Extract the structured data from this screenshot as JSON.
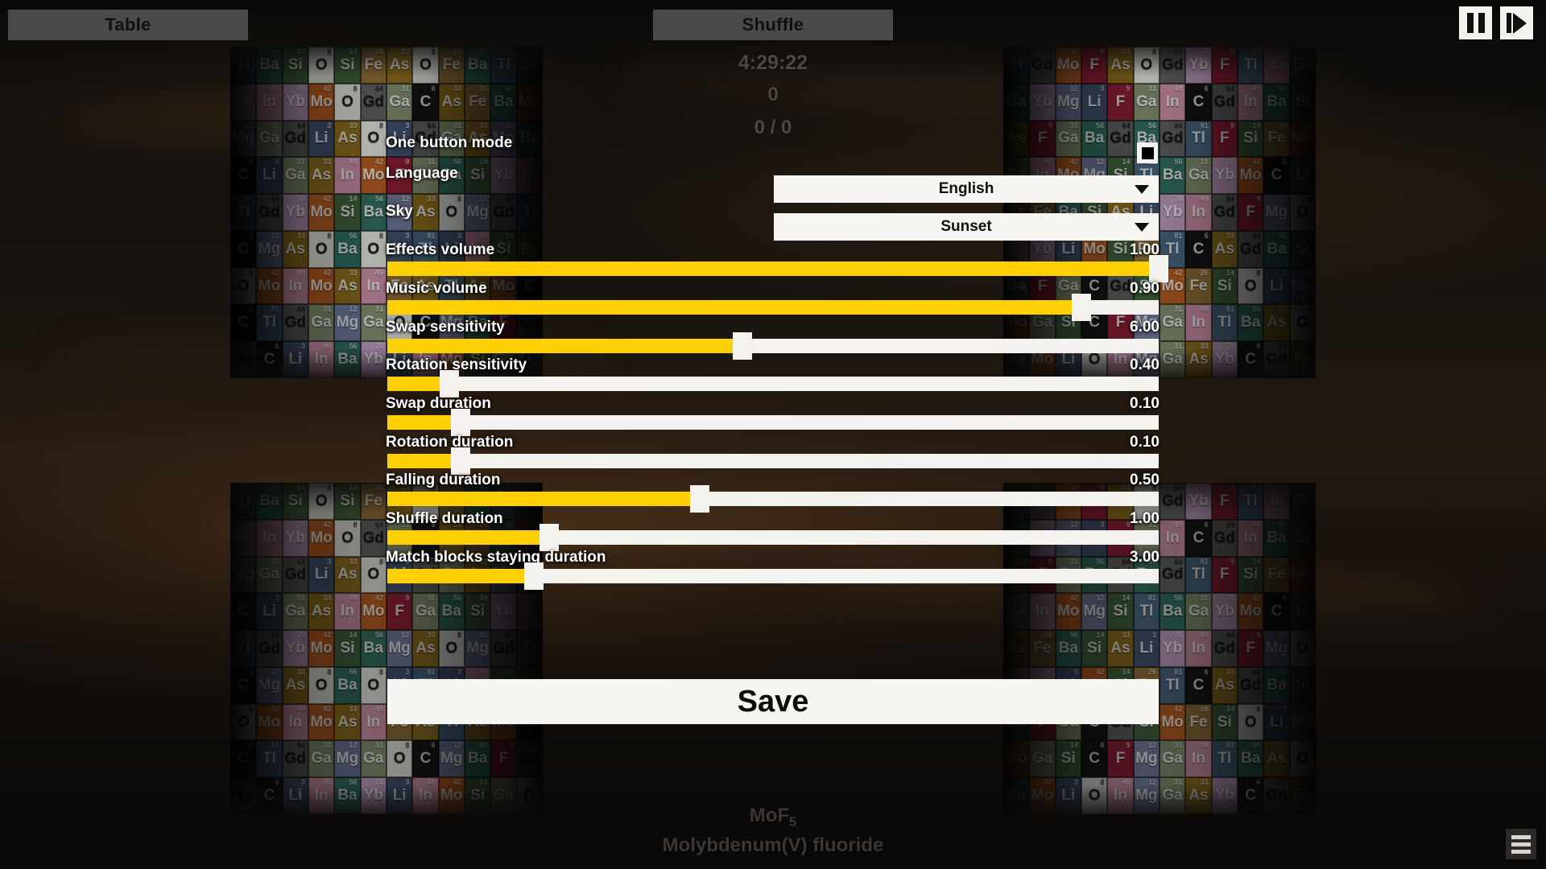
{
  "topbar": {
    "table_label": "Table",
    "shuffle_label": "Shuffle",
    "pause_icon": "pause-icon",
    "step_icon": "step-forward-icon"
  },
  "hud": {
    "timer": "4:29:22",
    "score": "0",
    "pairs": "0 / 0"
  },
  "settings": {
    "one_button_mode": {
      "label": "One button mode",
      "checked": false
    },
    "language": {
      "label": "Language",
      "value": "English"
    },
    "sky": {
      "label": "Sky",
      "value": "Sunset"
    },
    "sliders": [
      {
        "label": "Effects volume",
        "value": "1.00",
        "pct": 100.0
      },
      {
        "label": "Music volume",
        "value": "0.90",
        "pct": 90.0
      },
      {
        "label": "Swap sensitivity",
        "value": "6.00",
        "pct": 46.0
      },
      {
        "label": "Rotation sensitivity",
        "value": "0.40",
        "pct": 8.0
      },
      {
        "label": "Swap duration",
        "value": "0.10",
        "pct": 9.5
      },
      {
        "label": "Rotation duration",
        "value": "0.10",
        "pct": 9.5
      },
      {
        "label": "Falling duration",
        "value": "0.50",
        "pct": 40.5
      },
      {
        "label": "Shuffle duration",
        "value": "1.00",
        "pct": 21.0
      },
      {
        "label": "Match blocks staying duration",
        "value": "3.00",
        "pct": 19.0
      }
    ],
    "save_label": "Save"
  },
  "footer": {
    "formula_prefix": "MoF",
    "formula_subscript": "5",
    "compound_name": "Molybdenum(V) fluoride",
    "menu_icon": "list-menu-icon"
  },
  "colors": {
    "accent": "#ffd000",
    "panel": "#f7f5f1",
    "button": "#4a4a4a",
    "text_light": "#ffffff",
    "text_dim": "#4c4844"
  },
  "background": {
    "left_cylinder_rows": [
      [
        "Tl",
        "Ba",
        "Si",
        "O",
        "Si",
        "Fe",
        "As",
        "O",
        "Fe",
        "Ba",
        "Tl",
        "Si"
      ],
      [
        "Yb",
        "In",
        "Yb",
        "Mo",
        "O",
        "Gd",
        "Ga",
        "C",
        "As",
        "Fe",
        "Ba",
        "Mo"
      ],
      [
        "Mg",
        "Ga",
        "Gd",
        "Li",
        "As",
        "O",
        "Li",
        "Gd",
        "Ga",
        "As",
        "Mg",
        "Ba"
      ],
      [
        "C",
        "Li",
        "Ga",
        "As",
        "In",
        "Mo",
        "F",
        "Ga",
        "Ba",
        "Si",
        "Yb",
        "In"
      ],
      [
        "Tl",
        "Gd",
        "Yb",
        "Mo",
        "Si",
        "Ba",
        "Mg",
        "As",
        "O",
        "Mg",
        "Gd",
        "Tl"
      ],
      [
        "C",
        "Mg",
        "As",
        "O",
        "Ba",
        "O",
        "Li",
        "Tl",
        "Li",
        "In",
        "Si",
        "Fe"
      ],
      [
        "O",
        "Mo",
        "In",
        "Mo",
        "As",
        "In",
        "Fe",
        "As",
        "Tl",
        "As",
        "Mo",
        "C"
      ],
      [
        "C",
        "Tl",
        "Gd",
        "Ga",
        "Mg",
        "Ga",
        "O",
        "C",
        "Mg",
        "Ba",
        "F",
        "Gd"
      ],
      [
        "Gd",
        "C",
        "Li",
        "In",
        "Ba",
        "Yb",
        "Li",
        "In",
        "Mo",
        "Si",
        "Ga",
        "O"
      ]
    ],
    "right_cylinder_rows": [
      [
        "Tl",
        "Gd",
        "Mo",
        "F",
        "As",
        "O",
        "Gd",
        "Yb",
        "F",
        "Tl",
        "In",
        "Ba"
      ],
      [
        "Ba",
        "Yb",
        "Mg",
        "Li",
        "F",
        "Ga",
        "In",
        "C",
        "Gd",
        "In",
        "Ba",
        "Si"
      ],
      [
        "As",
        "F",
        "Ga",
        "Ba",
        "Gd",
        "Ba",
        "Gd",
        "Tl",
        "F",
        "Si",
        "Fe",
        "Mo"
      ],
      [
        "Ga",
        "In",
        "Mo",
        "Mg",
        "Si",
        "Tl",
        "Ba",
        "Ga",
        "Yb",
        "Mo",
        "C",
        "Li"
      ],
      [
        "As",
        "Fe",
        "Ba",
        "Si",
        "As",
        "Li",
        "Yb",
        "In",
        "Gd",
        "F",
        "Mg",
        "O"
      ],
      [
        "In",
        "Yb",
        "Li",
        "Mo",
        "Si",
        "Fe",
        "Tl",
        "C",
        "As",
        "Gd",
        "Ba",
        "Si"
      ],
      [
        "Ba",
        "F",
        "Ga",
        "C",
        "Gd",
        "Si",
        "Mo",
        "Fe",
        "Si",
        "O",
        "Li",
        "Mg"
      ],
      [
        "Mo",
        "Ga",
        "Si",
        "C",
        "F",
        "Mg",
        "Ga",
        "In",
        "Tl",
        "Ba",
        "As",
        "O"
      ],
      [
        "Ba",
        "Mo",
        "Li",
        "O",
        "In",
        "Mg",
        "Ga",
        "As",
        "Yb",
        "C",
        "Gd",
        "Fe"
      ]
    ],
    "element_colors": {
      "Tl": "#45627a",
      "Ba": "#2f6b5c",
      "Si": "#3d5e3a",
      "O": "#d9d9d4",
      "Fe": "#8a6a34",
      "As": "#8a6a1c",
      "Yb": "#b695b8",
      "In": "#c58aa2",
      "Mo": "#b0591f",
      "Gd": "#5c5c5c",
      "Ga": "#7d8a6b",
      "C": "#141414",
      "Mg": "#6b7496",
      "Li": "#3f4f6b",
      "F": "#8a1c33"
    }
  }
}
